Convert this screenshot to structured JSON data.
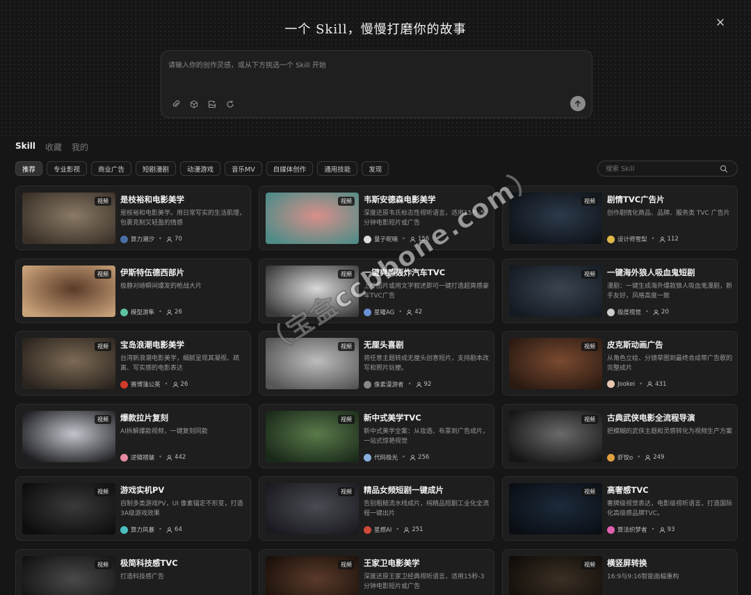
{
  "header": {
    "title": "一个 Skill，慢慢打磨你的故事",
    "close_icon": "close-icon"
  },
  "prompt": {
    "placeholder": "请输入你的创作灵感，或从下方挑选一个 Skill 开始",
    "tools": [
      "paperclip-icon",
      "cube-icon",
      "image-add-icon",
      "refresh-icon"
    ],
    "send_icon": "arrow-up-icon"
  },
  "tabs": [
    {
      "label": "Skill",
      "active": true
    },
    {
      "label": "收藏",
      "active": false
    },
    {
      "label": "我的",
      "active": false
    }
  ],
  "filters": [
    {
      "label": "推荐",
      "active": true
    },
    {
      "label": "专业影视",
      "active": false
    },
    {
      "label": "商业广告",
      "active": false
    },
    {
      "label": "短剧漫剧",
      "active": false
    },
    {
      "label": "动漫游戏",
      "active": false
    },
    {
      "label": "音乐MV",
      "active": false
    },
    {
      "label": "自媒体创作",
      "active": false
    },
    {
      "label": "通用技能",
      "active": false
    },
    {
      "label": "发现",
      "active": false
    }
  ],
  "search": {
    "placeholder": "搜索 Skill"
  },
  "watermark": "（宝盒ccbbone.com）",
  "cards": [
    {
      "title": "是枝裕和电影美学",
      "desc": "是枝裕和电影美学。用日常写实的生活肌理，包裹克制又轻盈的情感",
      "author": "算力潮汐",
      "uses": "70",
      "badge": "视频",
      "thumb": [
        "#8a7a66",
        "#3a3128"
      ],
      "avatar": "#4a6fa5"
    },
    {
      "title": "韦斯安德森电影美学",
      "desc": "深度还原韦氏标志性视听语言，适用15秒-5分钟电影短片或广告",
      "author": "量子呢喃",
      "uses": "156",
      "badge": "视频",
      "thumb": [
        "#d98f8a",
        "#4f8c87"
      ],
      "avatar": "#dddddd"
    },
    {
      "title": "剧情TVC广告片",
      "desc": "创作剧情化商品、品牌、服务类 TVC 广告片",
      "author": "设计师雪梨",
      "uses": "112",
      "badge": "视频",
      "thumb": [
        "#2b3a4a",
        "#0f1218"
      ],
      "avatar": "#e0b84a"
    },
    {
      "title": "伊斯特伍德西部片",
      "desc": "极静对峙瞬间爆发的枪战大片",
      "author": "模型游隼",
      "uses": "26",
      "badge": "视频",
      "thumb": [
        "#5a3a28",
        "#c9a27a"
      ],
      "avatar": "#5ec2a0"
    },
    {
      "title": "一键爽感轰炸汽车TVC",
      "desc": "上传图片或用文字叙述即可一键打造超爽感豪车TVC广告",
      "author": "星曜AG",
      "uses": "42",
      "badge": "视频",
      "thumb": [
        "#d9d9d9",
        "#3a3a3a"
      ],
      "avatar": "#6a8fd6"
    },
    {
      "title": "一键海外狼人吸血鬼短剧",
      "desc": "漫剧：一键生成海外爆款狼人吸血鬼漫剧，新手友好，风格高度一致",
      "author": "极度视觉",
      "uses": "20",
      "badge": "视频",
      "thumb": [
        "#3a4450",
        "#141a22"
      ],
      "avatar": "#cccccc"
    },
    {
      "title": "宝岛浪潮电影美学",
      "desc": "台湾新浪潮电影美学，细腻呈现其凝视、疏离、写实感的电影表达",
      "author": "赛博蒲公英",
      "uses": "26",
      "badge": "视频",
      "thumb": [
        "#7d6a55",
        "#2a241e"
      ],
      "avatar": "#d03a2a"
    },
    {
      "title": "无厘头喜剧",
      "desc": "将任意主题转成无厘头创意短片，支持剧本改写和照片玩梗。",
      "author": "像素漫游者",
      "uses": "92",
      "badge": "视频",
      "thumb": [
        "#bdbdbd",
        "#555555"
      ],
      "avatar": "#888888"
    },
    {
      "title": "皮克斯动画广告",
      "desc": "从角色立绘、分镜草图到最终合成带广告歌的完整成片",
      "author": "Jookei",
      "uses": "431",
      "badge": "视频",
      "thumb": [
        "#7a4a30",
        "#2a1a12"
      ],
      "avatar": "#e8c6b0"
    },
    {
      "title": "爆款拉片复刻",
      "desc": "AI拆解爆款视频，一键复刻同款",
      "author": "逆辑褶皱",
      "uses": "442",
      "badge": "视频",
      "thumb": [
        "#c2c6cc",
        "#1e1e22"
      ],
      "avatar": "#e88aa0"
    },
    {
      "title": "新中式美学TVC",
      "desc": "新中式美学全案：从妆造、布景到广告成片，一站式惊艳视觉",
      "author": "代码极光",
      "uses": "256",
      "badge": "视频",
      "thumb": [
        "#5a7a4a",
        "#1a2a1a"
      ],
      "avatar": "#8ab0e0"
    },
    {
      "title": "古典武侠电影全流程导演",
      "desc": "把模糊的武侠主题和灵感转化为视频生产方案",
      "author": "虾饺o",
      "uses": "249",
      "badge": "视频",
      "thumb": [
        "#6a6a6a",
        "#151515"
      ],
      "avatar": "#e0a040"
    },
    {
      "title": "游戏实机PV",
      "desc": "自制多类游戏PV，UI 像素锚定不形变，打造3A级游戏效果",
      "author": "算力风暴",
      "uses": "64",
      "badge": "视频",
      "thumb": [
        "#3a3a3a",
        "#0d0d0d"
      ],
      "avatar": "#4ac0c0"
    },
    {
      "title": "精品女频短剧一键成片",
      "desc": "告别粗糙流水线成片，纯精品短剧工业化全流程一键出片",
      "author": "星燃AI",
      "uses": "251",
      "badge": "视频",
      "thumb": [
        "#4a4a52",
        "#1a1a20"
      ],
      "avatar": "#d04a3a"
    },
    {
      "title": "高奢感TVC",
      "desc": "奢牌级视觉表达，电影级视听语言，打造国际化高级感品牌TVC。",
      "author": "算法织梦者",
      "uses": "93",
      "badge": "视频",
      "thumb": [
        "#1c2a3a",
        "#0a0e14"
      ],
      "avatar": "#e060b0"
    },
    {
      "title": "极简科技感TVC",
      "desc": "打造科技感广告",
      "author": "",
      "uses": "",
      "badge": "视频",
      "thumb": [
        "#4a4a4a",
        "#121212"
      ],
      "avatar": "#888888"
    },
    {
      "title": "王家卫电影美学",
      "desc": "深度还原王家卫经典视听语言，适用15秒-3分钟电影短片或广告",
      "author": "",
      "uses": "",
      "badge": "视频",
      "thumb": [
        "#5a3a2a",
        "#1a100a"
      ],
      "avatar": "#888888"
    },
    {
      "title": "横竖屏转换",
      "desc": "16:9与9:16智能画幅重构",
      "author": "",
      "uses": "",
      "badge": "视频",
      "thumb": [
        "#3a3024",
        "#100c08"
      ],
      "avatar": "#888888"
    }
  ]
}
